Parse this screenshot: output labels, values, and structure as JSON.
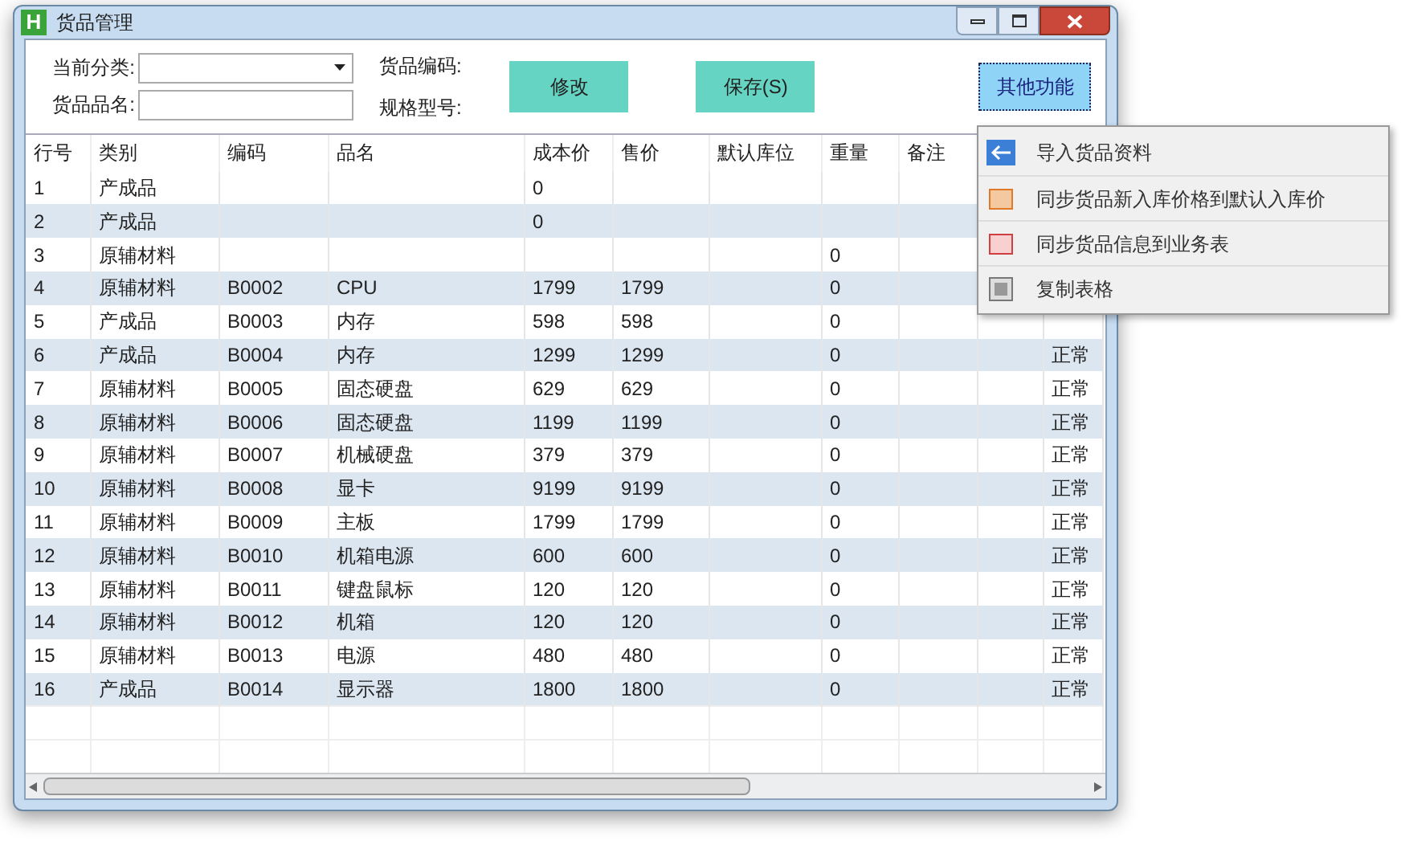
{
  "window": {
    "title": "货品管理",
    "logo": "H"
  },
  "filters": [
    {
      "label": "当前分类:",
      "kind": "dropdown"
    },
    {
      "label": "货品品名:",
      "kind": "text"
    }
  ],
  "filter_labels_right": [
    "货品编码:",
    "规格型号:"
  ],
  "buttons": [
    {
      "label": "修改",
      "pressed": false
    },
    {
      "label": "保存(S)",
      "pressed": false
    },
    {
      "label": "其他功能",
      "pressed": true
    }
  ],
  "menu": [
    {
      "label": "导入货品资料",
      "kind": "import"
    },
    {
      "label": "同步货品新入库价格到默认入库价",
      "kind": "sync-price"
    },
    {
      "label": "同步货品信息到业务表",
      "kind": "sync-table"
    },
    {
      "label": "复制表格",
      "kind": "copy"
    }
  ],
  "table": {
    "columns": [
      "行号",
      "类别",
      "编码",
      "品名",
      "成本价",
      "售价",
      "默认库位",
      "重量",
      "备注",
      null,
      null
    ],
    "rows": [
      [
        "1",
        "产成品",
        null,
        null,
        "0",
        null,
        null,
        null,
        null,
        null,
        null
      ],
      [
        "2",
        "产成品",
        null,
        null,
        "0",
        null,
        null,
        null,
        null,
        null,
        null
      ],
      [
        "3",
        "原辅材料",
        null,
        null,
        null,
        null,
        null,
        "0",
        null,
        null,
        null
      ],
      [
        "4",
        "原辅材料",
        "B0002",
        "CPU",
        "1799",
        "1799",
        null,
        "0",
        null,
        null,
        null
      ],
      [
        "5",
        "产成品",
        "B0003",
        "内存",
        "598",
        "598",
        null,
        "0",
        null,
        null,
        null
      ],
      [
        "6",
        "产成品",
        "B0004",
        "内存",
        "1299",
        "1299",
        null,
        "0",
        null,
        null,
        "正常"
      ],
      [
        "7",
        "原辅材料",
        "B0005",
        "固态硬盘",
        "629",
        "629",
        null,
        "0",
        null,
        null,
        "正常"
      ],
      [
        "8",
        "原辅材料",
        "B0006",
        "固态硬盘",
        "1199",
        "1199",
        null,
        "0",
        null,
        null,
        "正常"
      ],
      [
        "9",
        "原辅材料",
        "B0007",
        "机械硬盘",
        "379",
        "379",
        null,
        "0",
        null,
        null,
        "正常"
      ],
      [
        "10",
        "原辅材料",
        "B0008",
        "显卡",
        "9199",
        "9199",
        null,
        "0",
        null,
        null,
        "正常"
      ],
      [
        "11",
        "原辅材料",
        "B0009",
        "主板",
        "1799",
        "1799",
        null,
        "0",
        null,
        null,
        "正常"
      ],
      [
        "12",
        "原辅材料",
        "B0010",
        "机箱电源",
        "600",
        "600",
        null,
        "0",
        null,
        null,
        "正常"
      ],
      [
        "13",
        "原辅材料",
        "B0011",
        "键盘鼠标",
        "120",
        "120",
        null,
        "0",
        null,
        null,
        "正常"
      ],
      [
        "14",
        "原辅材料",
        "B0012",
        "机箱",
        "120",
        "120",
        null,
        "0",
        null,
        null,
        "正常"
      ],
      [
        "15",
        "原辅材料",
        "B0013",
        "电源",
        "480",
        "480",
        null,
        "0",
        null,
        null,
        "正常"
      ],
      [
        "16",
        "产成品",
        "B0014",
        "显示器",
        "1800",
        "1800",
        null,
        "0",
        null,
        null,
        "正常"
      ]
    ]
  }
}
